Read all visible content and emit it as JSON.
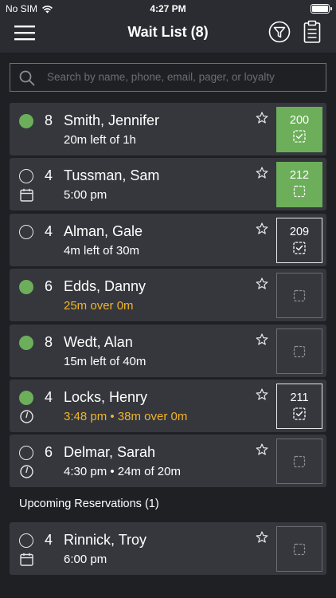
{
  "status_bar": {
    "carrier": "No SIM",
    "time": "4:27 PM"
  },
  "nav": {
    "title": "Wait List (8)",
    "menu_icon": "hamburger-menu-icon",
    "filter_icon": "filter-icon",
    "clipboard_icon": "clipboard-icon"
  },
  "search": {
    "placeholder": "Search by name, phone, email, pager, or loyalty",
    "value": ""
  },
  "colors": {
    "seated": "#6cae5a",
    "warning": "#f0b429",
    "card": "#35373d",
    "background": "#1e2024"
  },
  "waitlist": [
    {
      "party": "8",
      "name": "Smith, Jennifer",
      "status": "20m left of 1h",
      "status_warn": false,
      "dot": "seated",
      "sub_icon": "",
      "table": "200",
      "table_style": "filled",
      "table_icon": "checked-icon"
    },
    {
      "party": "4",
      "name": "Tussman, Sam",
      "status": "5:00 pm",
      "status_warn": false,
      "dot": "open",
      "sub_icon": "calendar-icon",
      "table": "212",
      "table_style": "filled",
      "table_icon": "square-icon"
    },
    {
      "party": "4",
      "name": "Alman, Gale",
      "status": "4m left of 30m",
      "status_warn": false,
      "dot": "open",
      "sub_icon": "",
      "table": "209",
      "table_style": "outline",
      "table_icon": "checked-icon"
    },
    {
      "party": "6",
      "name": "Edds, Danny",
      "status": "25m over 0m",
      "status_warn": true,
      "dot": "seated",
      "sub_icon": "",
      "table": "",
      "table_style": "empty",
      "table_icon": "square-icon"
    },
    {
      "party": "8",
      "name": "Wedt, Alan",
      "status": "15m left of 40m",
      "status_warn": false,
      "dot": "seated",
      "sub_icon": "",
      "table": "",
      "table_style": "empty",
      "table_icon": "square-icon"
    },
    {
      "party": "4",
      "name": "Locks, Henry",
      "status": "3:48 pm • 38m over 0m",
      "status_warn": true,
      "dot": "seated",
      "sub_icon": "clock-icon",
      "table": "211",
      "table_style": "outline",
      "table_icon": "checked-icon"
    },
    {
      "party": "6",
      "name": "Delmar, Sarah",
      "status": "4:30 pm • 24m of 20m",
      "status_warn": false,
      "dot": "open",
      "sub_icon": "clock-icon",
      "table": "",
      "table_style": "empty",
      "table_icon": "square-icon"
    }
  ],
  "upcoming": {
    "header": "Upcoming Reservations (1)",
    "items": [
      {
        "party": "4",
        "name": "Rinnick, Troy",
        "status": "6:00 pm",
        "status_warn": false,
        "dot": "open",
        "sub_icon": "calendar-icon",
        "table": "",
        "table_style": "empty",
        "table_icon": "square-icon"
      }
    ]
  }
}
